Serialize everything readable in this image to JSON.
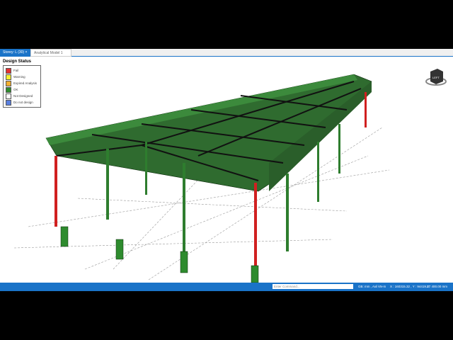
{
  "tabs": [
    {
      "label": "Storey: L (30)",
      "close": "×"
    },
    {
      "label": "Analytical Model 1"
    }
  ],
  "legend": {
    "title": "Design Status",
    "items": [
      {
        "label": "Fail",
        "color": "#e53030"
      },
      {
        "label": "Warning",
        "color": "#f5f032"
      },
      {
        "label": "Expired Analysis",
        "color": "#f5b030"
      },
      {
        "label": "OK",
        "color": "#2e8b2e"
      },
      {
        "label": "Not Designed",
        "color": "#ffffff"
      },
      {
        "label": "Do not design",
        "color": "#5a7fe0"
      }
    ]
  },
  "view_cube": {
    "label": "LEFT"
  },
  "status": {
    "command_placeholder": "Enter Command...",
    "units": "GB: mm , Axil kN-m",
    "coords": "X : 160315.32 , Y : 94419.37",
    "z": "Z : 400.00 mm"
  }
}
